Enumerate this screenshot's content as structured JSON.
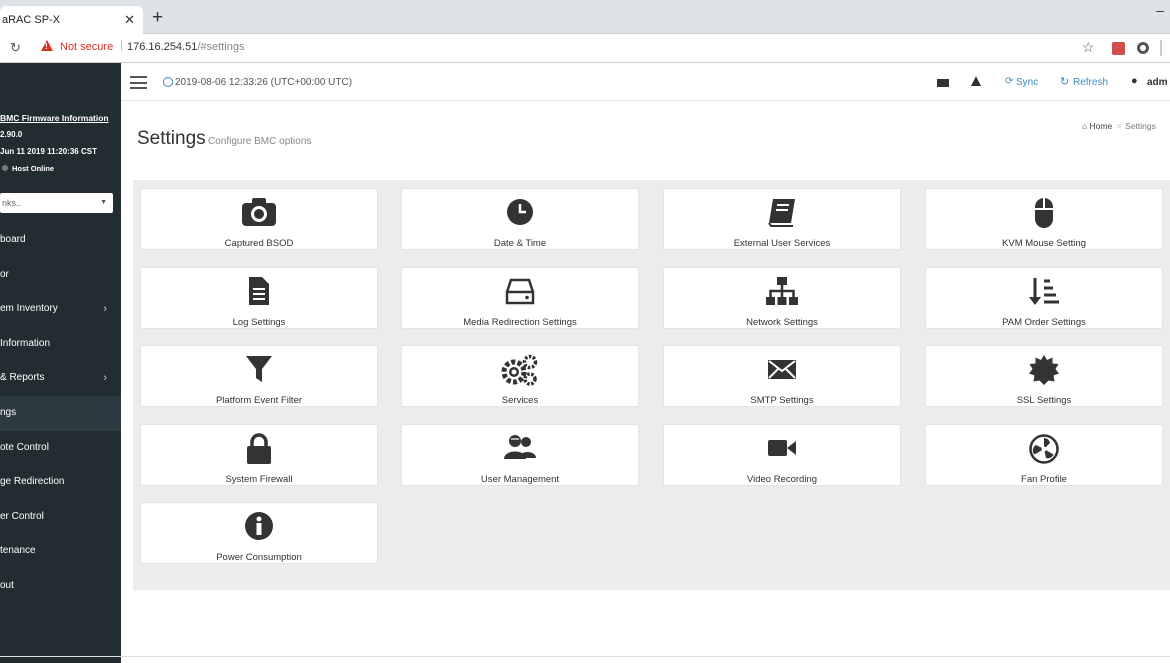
{
  "browser": {
    "tab_title": "aRAC SP-X",
    "tab_close": "✕",
    "new_tab": "+",
    "minimize": "–",
    "security_label": "Not secure",
    "url_host": "176.16.254.51",
    "url_path": "/#settings"
  },
  "sidebar": {
    "fw_title": "BMC Firmware Information",
    "fw_version": "2.90.0",
    "fw_date": "Jun 11 2019 11:20:36 CST",
    "host_status": "Host Online",
    "links_placeholder": "nks..",
    "items": [
      {
        "label": "board",
        "chevron": ""
      },
      {
        "label": "or",
        "chevron": ""
      },
      {
        "label": "em Inventory",
        "chevron": "›"
      },
      {
        "label": "Information",
        "chevron": ""
      },
      {
        "label": " & Reports",
        "chevron": "›"
      },
      {
        "label": "ngs",
        "chevron": ""
      },
      {
        "label": "ote Control",
        "chevron": ""
      },
      {
        "label": "ge Redirection",
        "chevron": ""
      },
      {
        "label": "er Control",
        "chevron": ""
      },
      {
        "label": "tenance",
        "chevron": ""
      },
      {
        "label": "out",
        "chevron": ""
      }
    ]
  },
  "header": {
    "datetime": "2019-08-06 12:33:26 (UTC+00:00 UTC)",
    "sync_label": "Sync",
    "refresh_label": "Refresh",
    "user_label": "adm"
  },
  "page": {
    "title": "Settings",
    "subtitle": "Configure BMC options",
    "breadcrumb_home": "Home",
    "breadcrumb_sep": ">",
    "breadcrumb_current": "Settings"
  },
  "cards": [
    {
      "label": "Captured BSOD",
      "icon": "camera-icon"
    },
    {
      "label": "Date & Time",
      "icon": "clock-icon"
    },
    {
      "label": "External User Services",
      "icon": "book-icon"
    },
    {
      "label": "KVM Mouse Setting",
      "icon": "mouse-icon"
    },
    {
      "label": "Log Settings",
      "icon": "file-text-icon"
    },
    {
      "label": "Media Redirection Settings",
      "icon": "hdd-icon"
    },
    {
      "label": "Network Settings",
      "icon": "sitemap-icon"
    },
    {
      "label": "PAM Order Settings",
      "icon": "sort-order-icon"
    },
    {
      "label": "Platform Event Filter",
      "icon": "filter-icon"
    },
    {
      "label": "Services",
      "icon": "gears-icon"
    },
    {
      "label": "SMTP Settings",
      "icon": "envelope-icon"
    },
    {
      "label": "SSL Settings",
      "icon": "certificate-icon"
    },
    {
      "label": "System Firewall",
      "icon": "lock-icon"
    },
    {
      "label": "User Management",
      "icon": "users-icon"
    },
    {
      "label": "Video Recording",
      "icon": "video-camera-icon"
    },
    {
      "label": "Fan Profile",
      "icon": "fan-icon"
    },
    {
      "label": "Power Consumption",
      "icon": "info-circle-icon"
    }
  ],
  "colors": {
    "sidebar_bg": "#222d32",
    "sidebar_active": "#2c3b41",
    "accent": "#3c8dbc",
    "warning": "#d93025",
    "content_bg": "#ececec"
  }
}
